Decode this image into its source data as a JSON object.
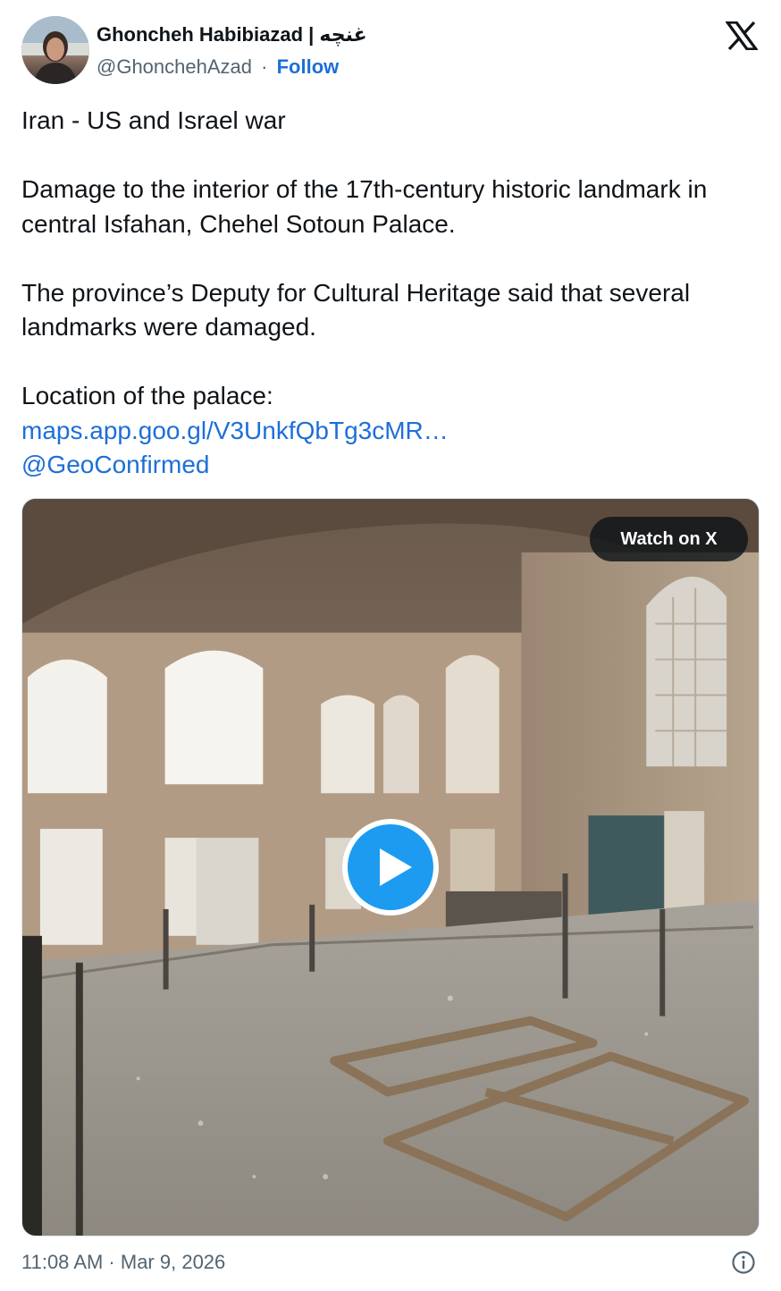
{
  "author": {
    "display_name": "Ghoncheh Habibiazad | غنچه",
    "handle": "@GhonchehAzad",
    "separator": "·",
    "follow_label": "Follow"
  },
  "brand": {
    "logo_icon": "x-logo-icon",
    "colors": {
      "text": "#0f1419",
      "secondary": "#536471",
      "link": "#1d6fd8",
      "play": "#1d9bf0"
    }
  },
  "tweet": {
    "line1": "Iran - US and Israel war",
    "para2": "Damage to the interior of the 17th-century historic landmark in central Isfahan, Chehel Sotoun Palace.",
    "para3": "The province’s Deputy for Cultural Heritage said that several landmarks were damaged.",
    "location_label": "Location of the palace:",
    "map_link": "maps.app.goo.gl/V3UnkfQbTg3cMR…",
    "mention": "@GeoConfirmed"
  },
  "media": {
    "watch_label": "Watch on X",
    "play_icon": "play-icon"
  },
  "footer": {
    "timestamp": "11:08 AM · Mar 9, 2026",
    "info_icon": "info-icon"
  }
}
